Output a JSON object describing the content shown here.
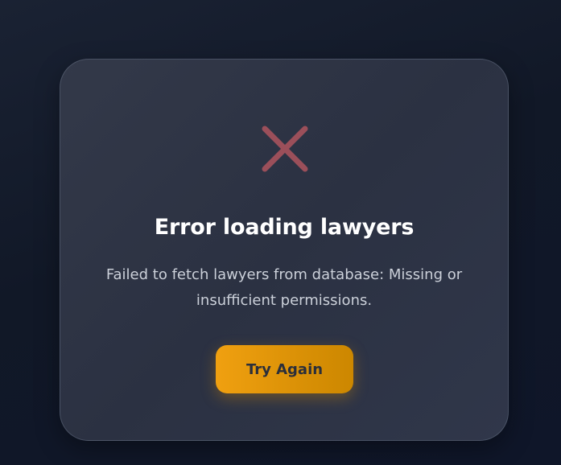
{
  "error_card": {
    "icon": "x-mark-icon",
    "icon_color": "#9b4f5a",
    "title": "Error loading lawyers",
    "message": "Failed to fetch lawyers from database: Missing or insufficient permissions.",
    "retry_label": "Try Again",
    "accent_color": "#f0a010"
  }
}
